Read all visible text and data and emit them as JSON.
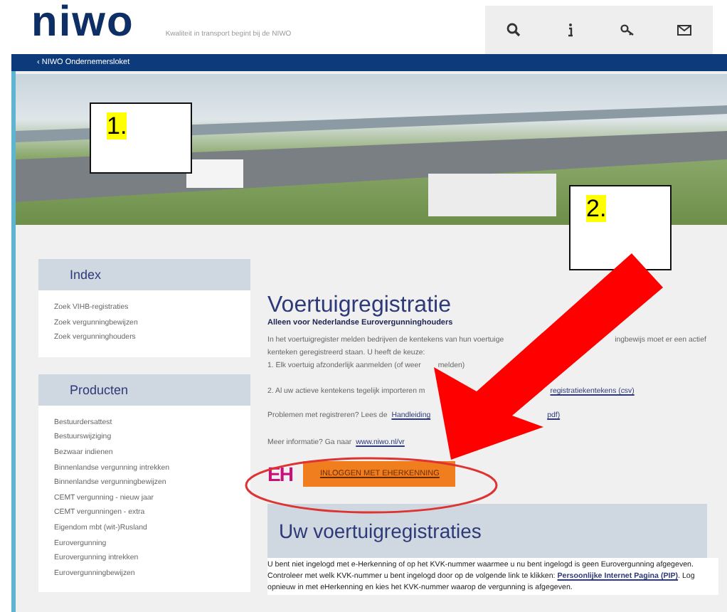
{
  "header": {
    "logo": "niwo",
    "tagline": "Kwaliteit in transport begint bij de NIWO"
  },
  "breadcrumb": "‹ NIWO Ondernemersloket",
  "sidebar": [
    {
      "title": "Index",
      "items": [
        "Zoek VIHB-registraties",
        "Zoek vergunningbewijzen",
        "Zoek vergunninghouders"
      ]
    },
    {
      "title": "Producten",
      "items": [
        "Bestuurdersattest",
        "Bestuurswijziging",
        "Bezwaar indienen",
        "Binnenlandse vergunning intrekken",
        "Binnenlandse vergunningbewijzen",
        "CEMT vergunning - nieuw jaar",
        "CEMT vergunningen - extra",
        "Eigendom mbt (wit-)Rusland",
        "Eurovergunning",
        "Eurovergunning intrekken",
        "Eurovergunningbewijzen"
      ]
    }
  ],
  "main": {
    "title": "Voertuigregistratie",
    "subtitle": "Alleen voor Nederlandse Eurovergunninghouders",
    "lines": [
      {
        "parts": [
          {
            "kind": "text",
            "text": "In het voertuigregister melden bedrijven de kentekens van hun voertuige"
          },
          {
            "kind": "text",
            "text": "ingbewijs moet er een actief"
          }
        ]
      },
      {
        "parts": [
          {
            "kind": "text",
            "text": "kenteken geregistreerd staan. U heeft de keuze:"
          }
        ]
      },
      {
        "parts": [
          {
            "kind": "text",
            "text": "1. Elk voertuig afzonderlijk aanmelden (of weer"
          },
          {
            "kind": "text",
            "text": "melden)"
          }
        ]
      },
      {
        "parts": [
          {
            "kind": "text",
            "text": "2. Al uw actieve kentekens tegelijk importeren m"
          },
          {
            "kind": "link",
            "text": "registratiekentekens (csv)"
          }
        ]
      },
      {
        "parts": [
          {
            "kind": "text",
            "text": "Problemen met registreren? Lees de"
          },
          {
            "kind": "link",
            "text": "Handleiding"
          },
          {
            "kind": "link",
            "text": "pdf)"
          }
        ]
      },
      {
        "parts": [
          {
            "kind": "text",
            "text": "Meer informatie? Ga naar"
          },
          {
            "kind": "link",
            "text": "www.niwo.nl/vr"
          }
        ]
      }
    ],
    "login": {
      "logo": "EH",
      "button": "INLOGGEN MET EHERKENNING"
    },
    "section_title": "Uw voertuigregistraties",
    "notice": "U bent niet ingelogd met e-Herkenning of op het KVK-nummer waarmee u nu bent ingelogd is geen Eurovergunning afgegeven. Controleer met welk KVK-nummer u bent ingelogd door op de volgende link te klikken: **Persoonlijke Internet Pagina (PIP)**. Log opnieuw in met eHerkenning en kies het KVK-nummer waarop de vergunning is afgegeven."
  },
  "annotations": [
    {
      "label": "1."
    },
    {
      "label": "2."
    }
  ]
}
